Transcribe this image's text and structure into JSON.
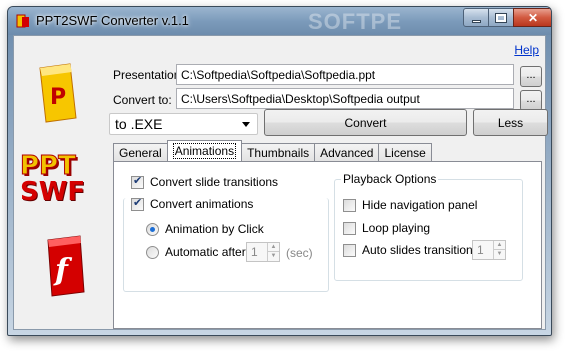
{
  "window": {
    "title": "PPT2SWF Converter v.1.1",
    "watermark": "SOFTPE"
  },
  "header": {
    "help_label": "Help"
  },
  "fields": {
    "presentation_label": "Presentation:",
    "presentation_value": "C:\\Softpedia\\Softpedia\\Softpedia.ppt",
    "convert_to_label": "Convert to:",
    "convert_to_value": "C:\\Users\\Softpedia\\Desktop\\Softpedia output",
    "browse_label": "..."
  },
  "format": {
    "selected": "to .EXE"
  },
  "buttons": {
    "convert": "Convert",
    "less": "Less"
  },
  "tabs": [
    "General",
    "Animations",
    "Thumbnails",
    "Advanced",
    "License"
  ],
  "active_tab": "Animations",
  "animations": {
    "convert_slide_transitions": {
      "label": "Convert slide transitions",
      "checked": true
    },
    "convert_animations": {
      "label": "Convert animations",
      "checked": true
    },
    "animation_by_click": {
      "label": "Animation by Click",
      "selected": true
    },
    "automatic_after": {
      "label": "Automatic after",
      "selected": false,
      "value": "1",
      "unit": "(sec)"
    }
  },
  "playback": {
    "title": "Playback Options",
    "hide_navigation_panel": {
      "label": "Hide navigation panel",
      "checked": false
    },
    "loop_playing": {
      "label": "Loop playing",
      "checked": false
    },
    "auto_slides_transitions": {
      "label": "Auto slides transitions",
      "checked": false,
      "value": "1"
    }
  },
  "logo": {
    "line1": "PPT",
    "line2": "SWF"
  },
  "colors": {
    "logo_yellow": "#f2c200",
    "logo_red": "#d40000",
    "link_blue": "#0033cc",
    "titlebar": "#7c9bbb"
  }
}
